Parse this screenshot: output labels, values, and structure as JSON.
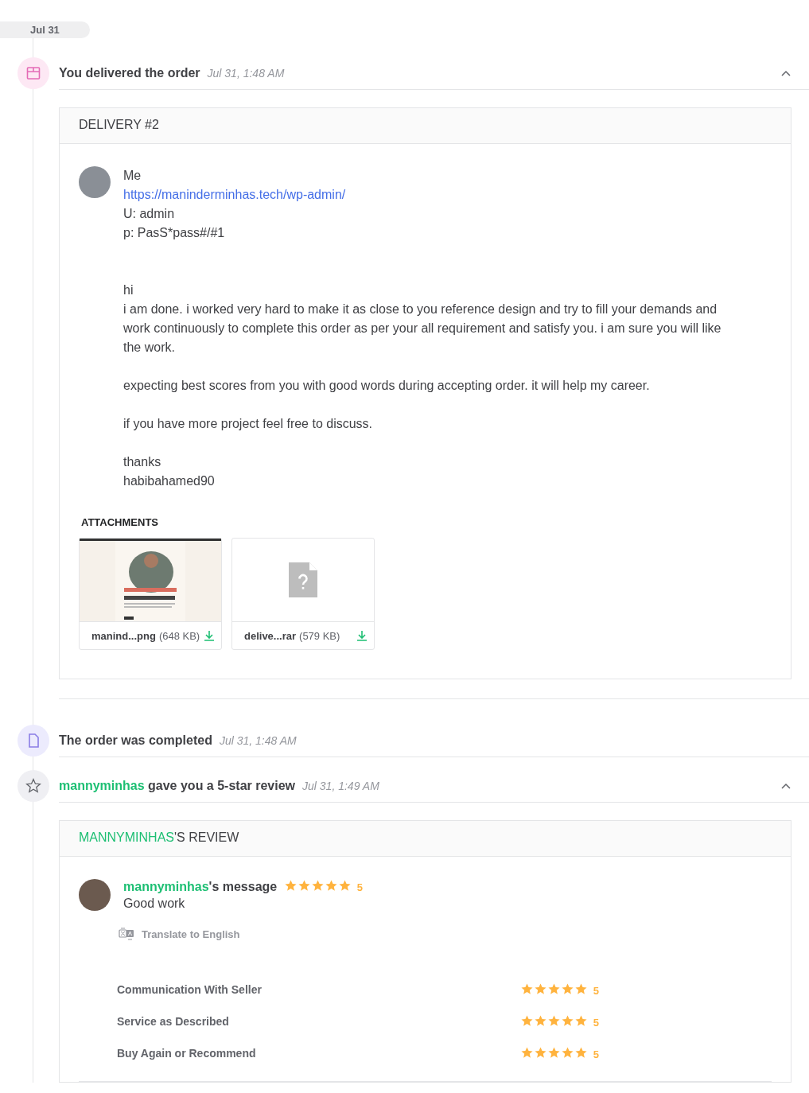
{
  "date_pill": "Jul 31",
  "delivered_event": {
    "title": "You delivered the order",
    "time": "Jul 31, 1:48 AM",
    "expanded": true,
    "delivery": {
      "header": "DELIVERY #2",
      "sender": "Me",
      "lines": [
        {
          "kind": "link",
          "text": "https://maninderminhas.tech/wp-admin/"
        },
        {
          "kind": "text",
          "text": "U: admin"
        },
        {
          "kind": "text",
          "text": "p: PasS*pass#/#1"
        }
      ],
      "paragraphs": [
        "hi\ni am done. i worked very hard to make it as close to you reference design and try to fill your demands and work continuously to complete this order as per your all requirement and satisfy you. i am sure you will like the work.",
        "expecting best scores from you with good words during accepting order. it will help my career.",
        "if you have more project feel free to discuss.",
        "thanks\nhabibahamed90"
      ],
      "attachments_title": "ATTACHMENTS",
      "attachments": [
        {
          "kind": "image",
          "name": "manind...png",
          "size": "(648 KB)"
        },
        {
          "kind": "unknown",
          "name": "delive...rar",
          "size": "(579 KB)"
        }
      ]
    }
  },
  "completed_event": {
    "title": "The order was completed",
    "time": "Jul 31, 1:48 AM"
  },
  "review_event": {
    "reviewer": "mannyminhas",
    "title": "gave you a 5-star review",
    "time": "Jul 31, 1:49 AM",
    "expanded": true,
    "review": {
      "header_name": "MANNYMINHAS",
      "header_suffix": "'S REVIEW",
      "author": "mannyminhas",
      "author_suffix": "'s message",
      "stars": 5,
      "rating": "5",
      "message": "Good work",
      "translate": "Translate to English",
      "ratings": [
        {
          "label": "Communication With Seller",
          "stars": 5,
          "value": "5"
        },
        {
          "label": "Service as Described",
          "stars": 5,
          "value": "5"
        },
        {
          "label": "Buy Again or Recommend",
          "stars": 5,
          "value": "5"
        }
      ]
    }
  }
}
